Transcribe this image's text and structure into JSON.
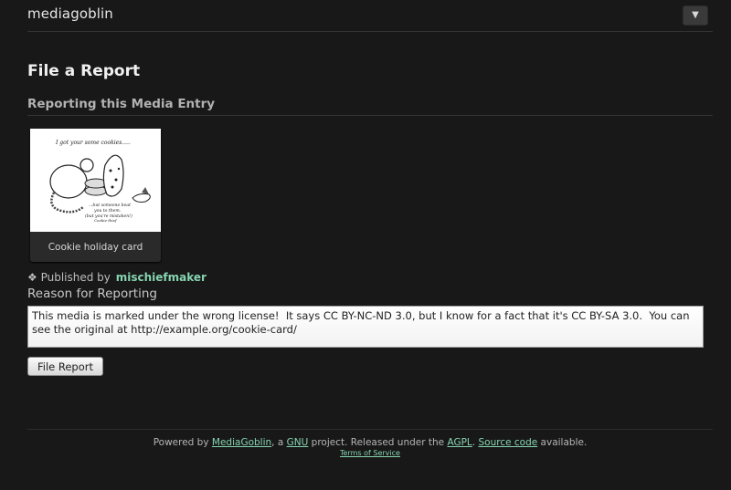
{
  "header": {
    "site_name": "mediagoblin",
    "menu_toggle_icon": "triangle-down-icon",
    "menu_toggle_glyph": "▼"
  },
  "page": {
    "title": "File a Report",
    "subtitle": "Reporting this Media Entry"
  },
  "media": {
    "title": "Cookie holiday card",
    "thumbnail_caption_top": "I got your some cookies.....",
    "thumbnail_caption_bottom": "...but someone beat you to them. (but you're mistaken!) Cookie thief..."
  },
  "published": {
    "icon": "diamond-ornament-icon",
    "icon_glyph": "❖",
    "prefix": "Published by",
    "author": "mischiefmaker"
  },
  "form": {
    "reason_label": "Reason for Reporting",
    "reason_value": "This media is marked under the wrong license!  It says CC BY-NC-ND 3.0, but I know for a fact that it's CC BY-SA 3.0.  You can see the original at http://example.org/cookie-card/",
    "submit_label": "File Report"
  },
  "footer": {
    "powered_by": "Powered by ",
    "mediagoblin_link": "MediaGoblin",
    "a_text": ", a ",
    "gnu_link": "GNU",
    "released_text": " project. Released under the ",
    "agpl_link": "AGPL",
    "period": ". ",
    "source_link": "Source code",
    "available_text": " available.",
    "tos_link": "Terms of Service"
  },
  "colors": {
    "background": "#181818",
    "link": "#86d4b1",
    "text": "#c3c3c3"
  }
}
